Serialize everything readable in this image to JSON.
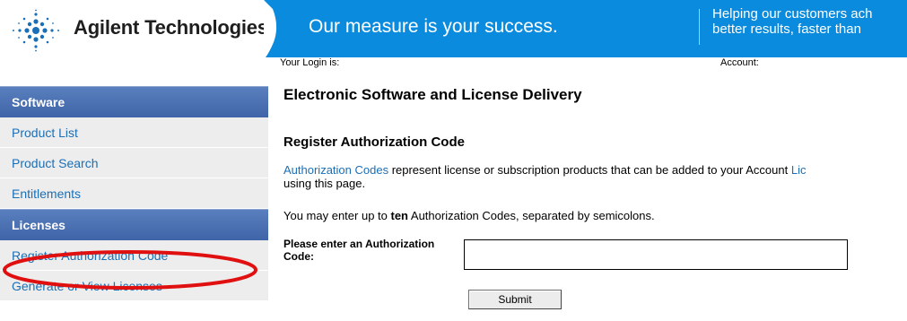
{
  "header": {
    "brand": "Agilent Technologies",
    "tagline": "Our measure is your success.",
    "promo_line1": "Helping our customers ach",
    "promo_line2": "better results, faster than",
    "colors": {
      "banner": "#0a8bde",
      "brand_text": "#1e1e1e"
    }
  },
  "account_bar": {
    "login_label": "Your Login is:",
    "account_label": "Account:"
  },
  "sidebar": {
    "sections": [
      {
        "title": "Software",
        "items": [
          "Product List",
          "Product Search",
          "Entitlements"
        ]
      },
      {
        "title": "Licenses",
        "items": [
          "Register Authorization Code",
          "Generate or View Licenses"
        ]
      }
    ],
    "highlighted_item": "Register Authorization Code",
    "highlight_color": "#e01010"
  },
  "main": {
    "page_title": "Electronic Software and License Delivery",
    "section_title": "Register Authorization Code",
    "desc_link": "Authorization Codes",
    "desc_text": " represent license or subscription products that can be added to your Account ",
    "desc_link2": "Lic",
    "desc_line2": "using this page.",
    "limit_prefix": "You may enter up to ",
    "limit_bold": "ten",
    "limit_suffix": " Authorization Codes, separated by semicolons.",
    "field_label": "Please enter an Authorization Code:",
    "input_value": "",
    "submit_label": "Submit"
  }
}
